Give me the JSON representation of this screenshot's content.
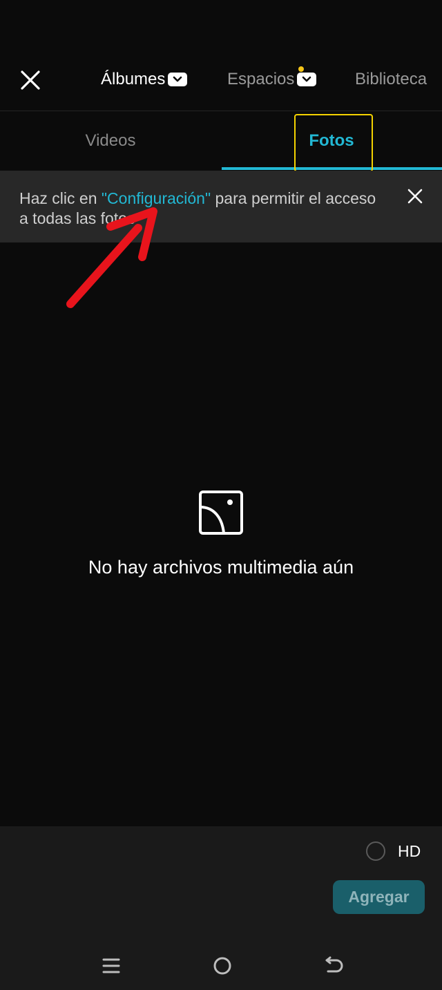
{
  "header": {
    "tabs": [
      {
        "label": "Álbumes"
      },
      {
        "label": "Espacios"
      },
      {
        "label": "Biblioteca"
      }
    ]
  },
  "subtabs": {
    "items": [
      {
        "label": "Videos"
      },
      {
        "label": "Fotos"
      }
    ]
  },
  "banner": {
    "text_before": "Haz clic en ",
    "link_text": "\"Configuración\"",
    "text_after": " para permitir el acceso a todas las fotos"
  },
  "empty_state": {
    "message": "No hay archivos multimedia aún"
  },
  "bottom": {
    "hd_label": "HD",
    "add_label": "Agregar"
  },
  "colors": {
    "accent": "#22b8d4",
    "highlight": "#f5d300",
    "annotation": "#e8141c",
    "notification": "#f5c518"
  },
  "icons": {
    "close": "close-icon",
    "dropdown": "chevron-down-icon",
    "empty": "image-placeholder-icon",
    "nav_recent": "menu-icon",
    "nav_home": "home-icon",
    "nav_back": "back-icon"
  }
}
